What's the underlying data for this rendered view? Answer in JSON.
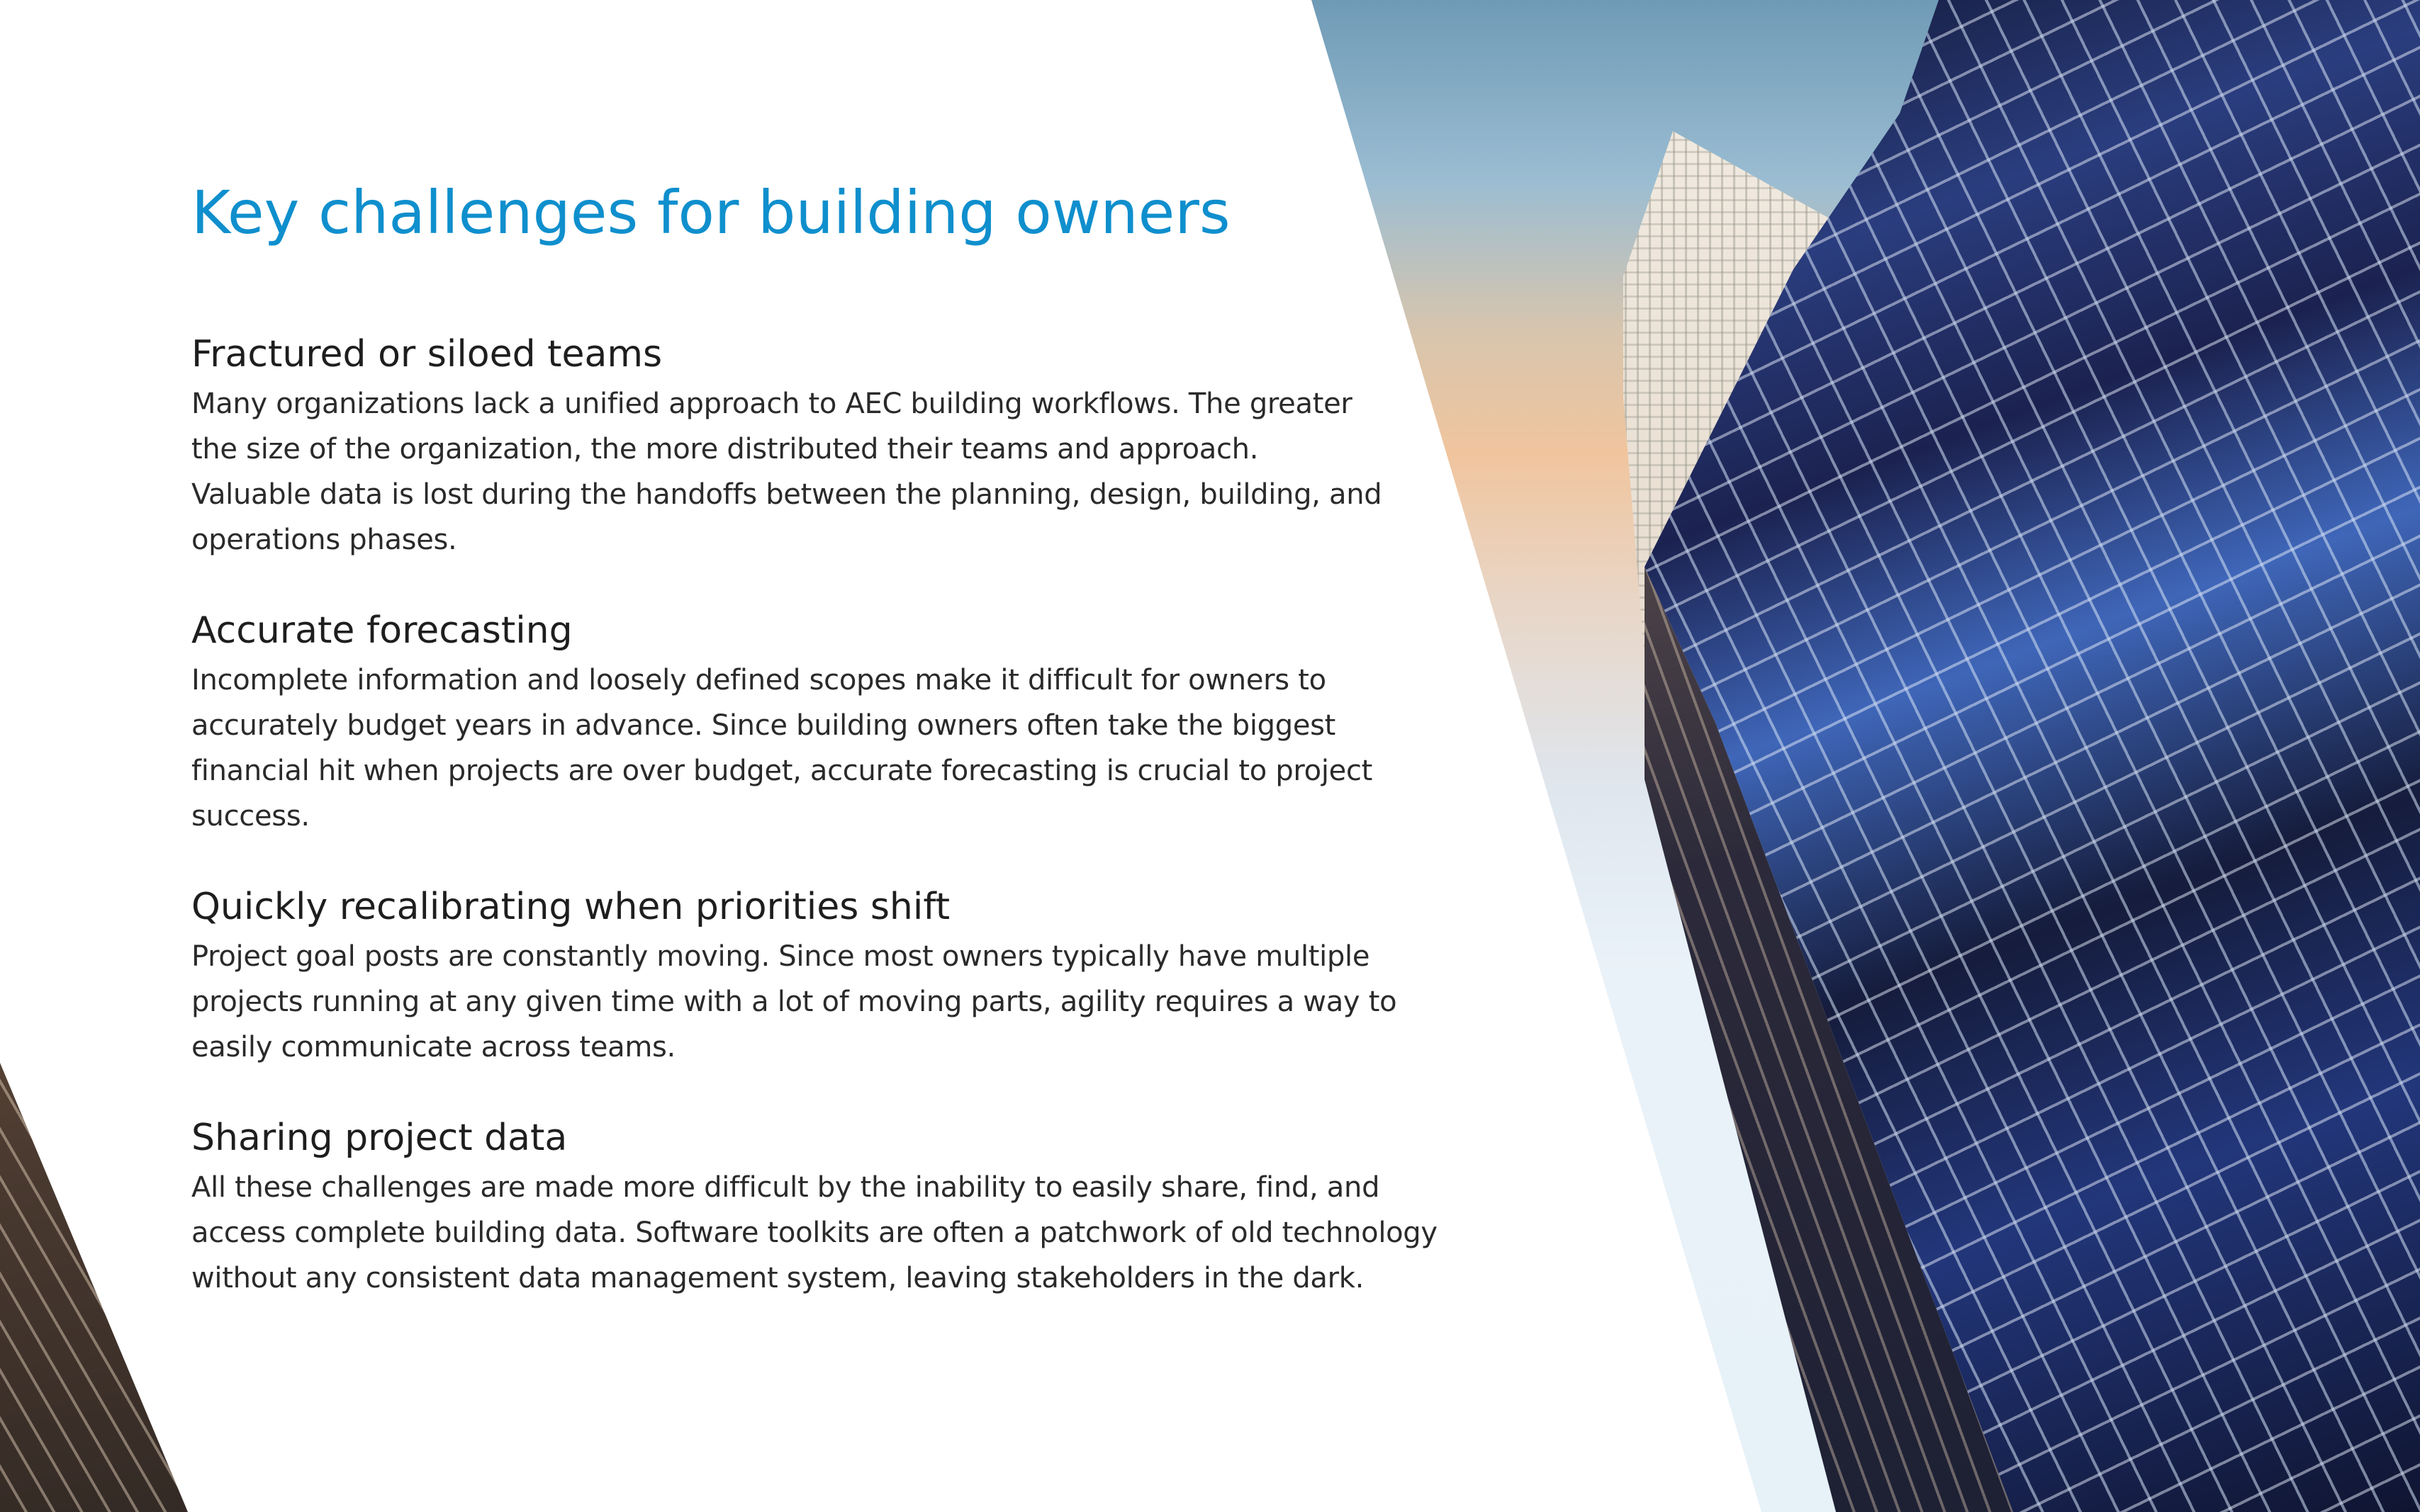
{
  "title": "Key challenges for building owners",
  "sections": [
    {
      "heading": "Fractured or siloed teams",
      "lines": [
        "Many organizations lack a unified approach to AEC building workflows. The greater",
        "the size of the organization, the more distributed their teams and approach.",
        "Valuable data is lost during the handoffs between the planning, design, building, and",
        "operations phases."
      ]
    },
    {
      "heading": "Accurate forecasting",
      "lines": [
        "Incomplete information and loosely defined scopes make it difficult for owners to",
        "accurately budget years in advance. Since building owners often take the biggest",
        "financial hit when projects are over budget, accurate forecasting is crucial to project",
        "success."
      ]
    },
    {
      "heading": "Quickly recalibrating when priorities shift",
      "lines": [
        "Project goal posts are constantly moving. Since most owners typically have multiple",
        "projects running at any given time with a lot of moving parts, agility requires a way to",
        "easily communicate across teams."
      ]
    },
    {
      "heading": "Sharing project data",
      "lines": [
        "All these challenges are made more difficult by the inability to easily share, find, and",
        "access complete building data. Software toolkits are often a patchwork of old technology",
        "without any consistent data management system, leaving stakeholders in the dark."
      ]
    }
  ],
  "colors": {
    "title": "#0f8fcd",
    "heading": "#1e1e1e",
    "body": "#2a2a2a"
  }
}
